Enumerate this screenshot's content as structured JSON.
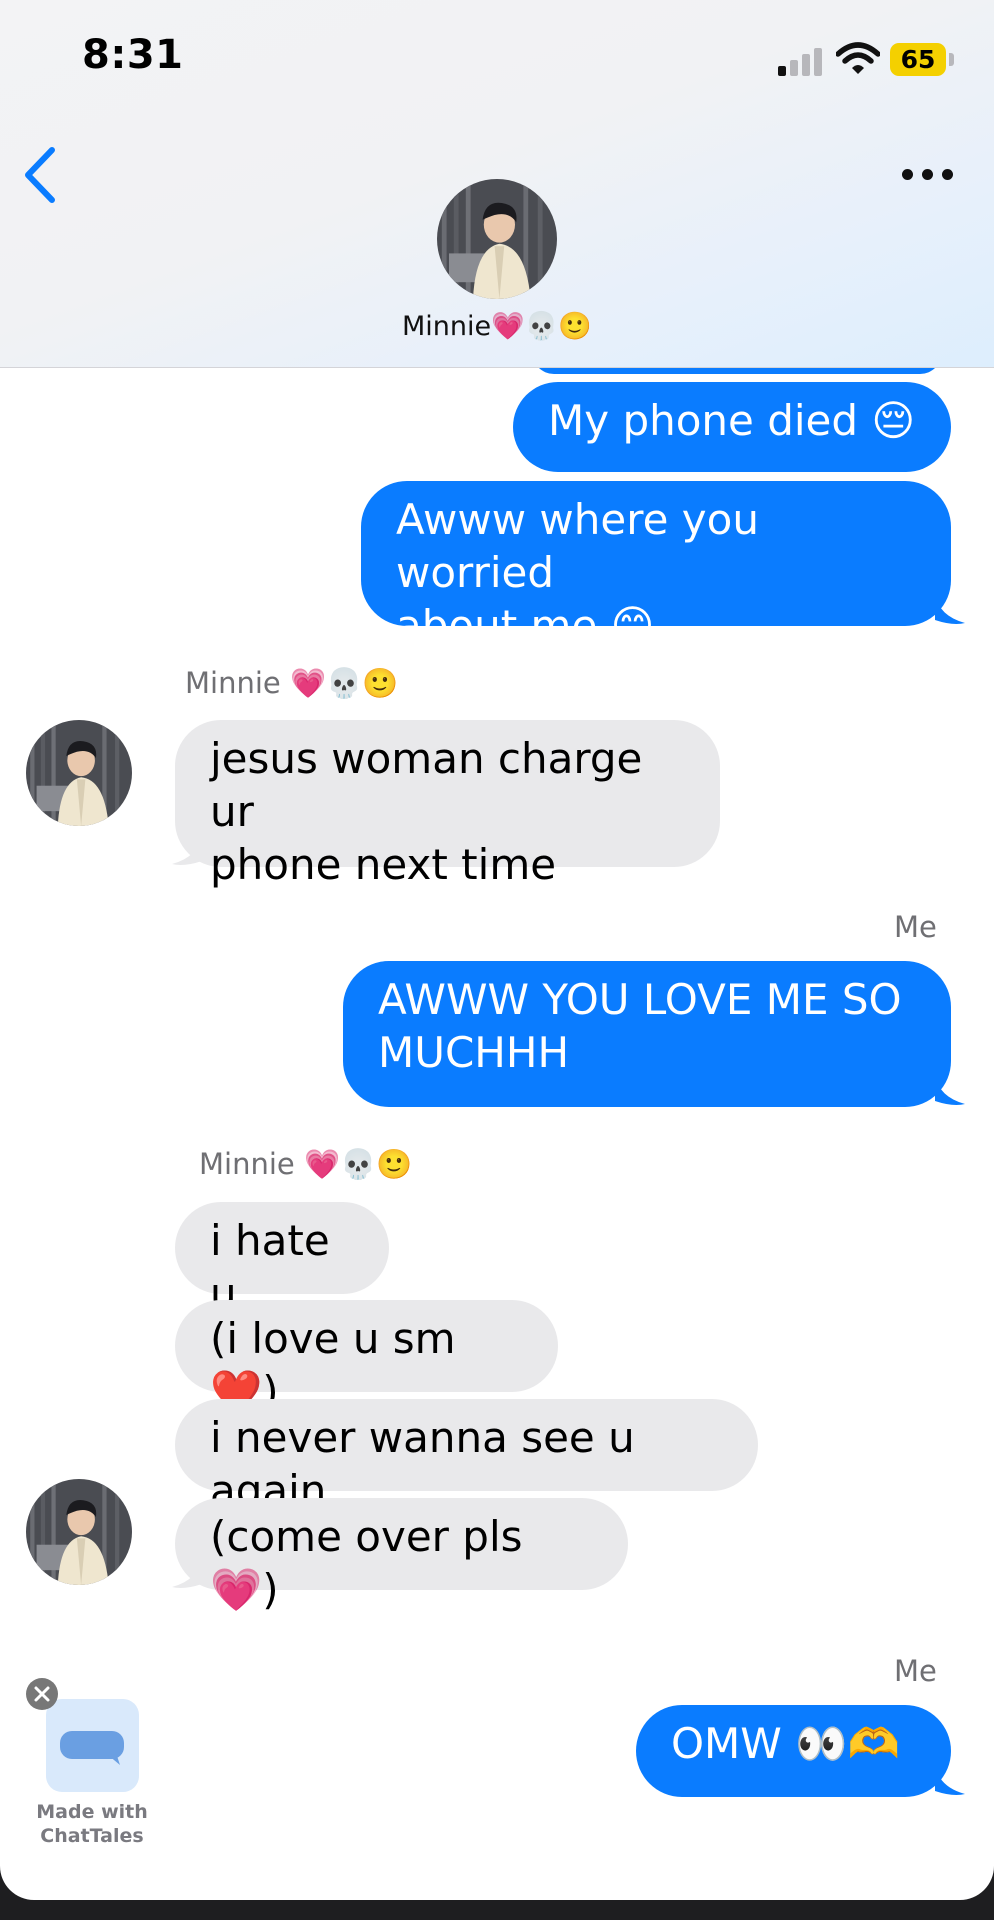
{
  "status_bar": {
    "time": "8:31",
    "battery_level": "65",
    "signal_bars_active": 1,
    "signal_bars_total": 4,
    "colors": {
      "battery_fill": "#f4d000"
    }
  },
  "header": {
    "back_icon": "chevron-left-icon",
    "more_icon": "ellipsis-icon",
    "contact_name": "Minnie💗💀🙂"
  },
  "colors": {
    "sent_bubble": "#0a7cff",
    "received_bubble": "#e9e9eb",
    "accent": "#0a7cff"
  },
  "messages": [
    {
      "direction": "sent",
      "text": "My phone died 😔"
    },
    {
      "direction": "sent",
      "text": "Awww where you worried\nabout me 😊"
    },
    {
      "sender_label": "Minnie 💗💀🙂"
    },
    {
      "direction": "received",
      "text": "jesus woman charge ur\nphone next time"
    },
    {
      "sender_label": "Me"
    },
    {
      "direction": "sent",
      "text": "AWWW YOU LOVE ME SO\nMUCHHH"
    },
    {
      "sender_label": "Minnie 💗💀🙂"
    },
    {
      "direction": "received",
      "text": "i hate u"
    },
    {
      "direction": "received",
      "text": "(i love u sm ❤️)"
    },
    {
      "direction": "received",
      "text": "i never wanna see u again"
    },
    {
      "direction": "received",
      "text": "(come over pls 💗)"
    },
    {
      "sender_label": "Me"
    },
    {
      "direction": "sent",
      "text": "OMW 👀🫶"
    }
  ],
  "watermark": {
    "text": "Made with\nChatTales",
    "close_icon": "close-icon"
  }
}
